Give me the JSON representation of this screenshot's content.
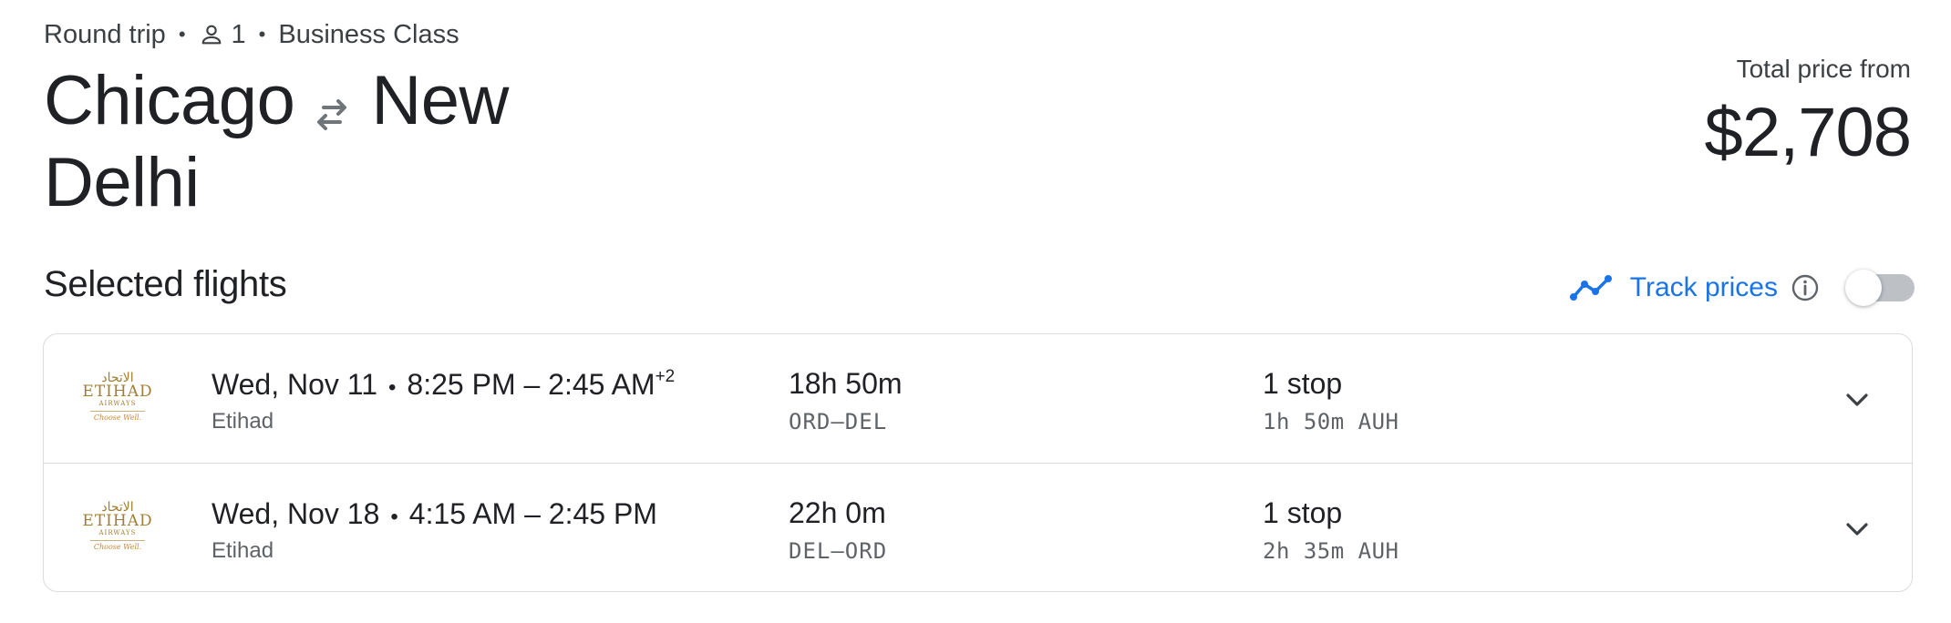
{
  "trip": {
    "type": "Round trip",
    "passengers": "1",
    "cabin": "Business Class"
  },
  "route": {
    "origin": "Chicago",
    "destination": "New Delhi"
  },
  "price": {
    "label": "Total price from",
    "value": "$2,708"
  },
  "section": {
    "title": "Selected flights"
  },
  "track": {
    "label": "Track prices",
    "enabled": false,
    "accent_color": "#1a73e8"
  },
  "flights": [
    {
      "date": "Wed, Nov 11",
      "time_range": "8:25 PM – 2:45 AM",
      "day_offset": "+2",
      "airline": "Etihad",
      "duration": "18h 50m",
      "airports": "ORD–DEL",
      "stops": "1 stop",
      "layover": "1h 50m AUH",
      "logo_text": {
        "arabic": "الاتحاد",
        "name": "ETIHAD",
        "sub": "AIRWAYS",
        "tagline": "Choose Well."
      }
    },
    {
      "date": "Wed, Nov 18",
      "time_range": "4:15 AM – 2:45 PM",
      "day_offset": "",
      "airline": "Etihad",
      "duration": "22h 0m",
      "airports": "DEL–ORD",
      "stops": "1 stop",
      "layover": "2h 35m AUH",
      "logo_text": {
        "arabic": "الاتحاد",
        "name": "ETIHAD",
        "sub": "AIRWAYS",
        "tagline": "Choose Well."
      }
    }
  ],
  "icons": {
    "passenger": "person-outline-icon",
    "swap": "swap-arrows-icon",
    "track": "trending-line-icon",
    "info": "info-circle-icon",
    "expand": "chevron-down-icon"
  }
}
